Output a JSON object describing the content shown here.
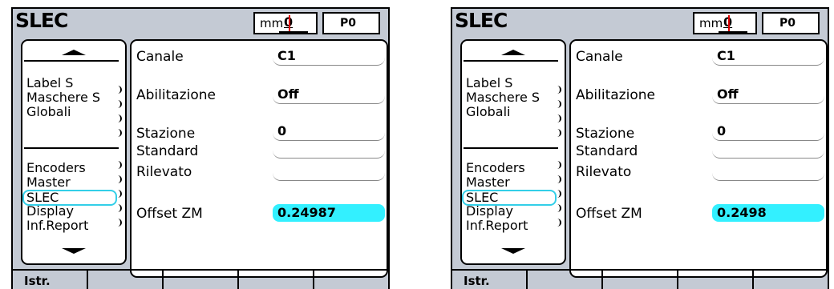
{
  "screens": [
    {
      "title": "SLEC",
      "units": "mm",
      "resolution_digit": "0",
      "program": "P0",
      "menu": {
        "items": [
          "Label S",
          "Maschere S",
          "Globali",
          "Encoders",
          "Master",
          "SLEC",
          "Display",
          "Inf.Report"
        ],
        "selected": "SLEC"
      },
      "fields": {
        "canale_label": "Canale",
        "canale_value": "C1",
        "abilitazione_label": "Abilitazione",
        "abilitazione_value": "Off",
        "stazione_label": "Stazione",
        "stazione_value": "0",
        "standard_label": "Standard",
        "standard_value": "",
        "rilevato_label": "Rilevato",
        "rilevato_value": "",
        "offset_label": "Offset ZM",
        "offset_value": "0.24987"
      },
      "softkeys": [
        "Istr.",
        "",
        "",
        "",
        ""
      ]
    },
    {
      "title": "SLEC",
      "units": "mm",
      "resolution_digit": "0",
      "program": "P0",
      "menu": {
        "items": [
          "Label S",
          "Maschere S",
          "Globali",
          "Encoders",
          "Master",
          "SLEC",
          "Display",
          "Inf.Report"
        ],
        "selected": "SLEC"
      },
      "fields": {
        "canale_label": "Canale",
        "canale_value": "C1",
        "abilitazione_label": "Abilitazione",
        "abilitazione_value": "Off",
        "stazione_label": "Stazione",
        "stazione_value": "0",
        "standard_label": "Standard",
        "standard_value": "",
        "rilevato_label": "Rilevato",
        "rilevato_value": "",
        "offset_label": "Offset ZM",
        "offset_value": "0.2498"
      },
      "softkeys": [
        "Istr.",
        "",
        "",
        "",
        ""
      ]
    }
  ],
  "colors": {
    "highlight": "#33f0ff",
    "selection_border": "#33cfe8",
    "screen_bg": "#c4cad4"
  }
}
